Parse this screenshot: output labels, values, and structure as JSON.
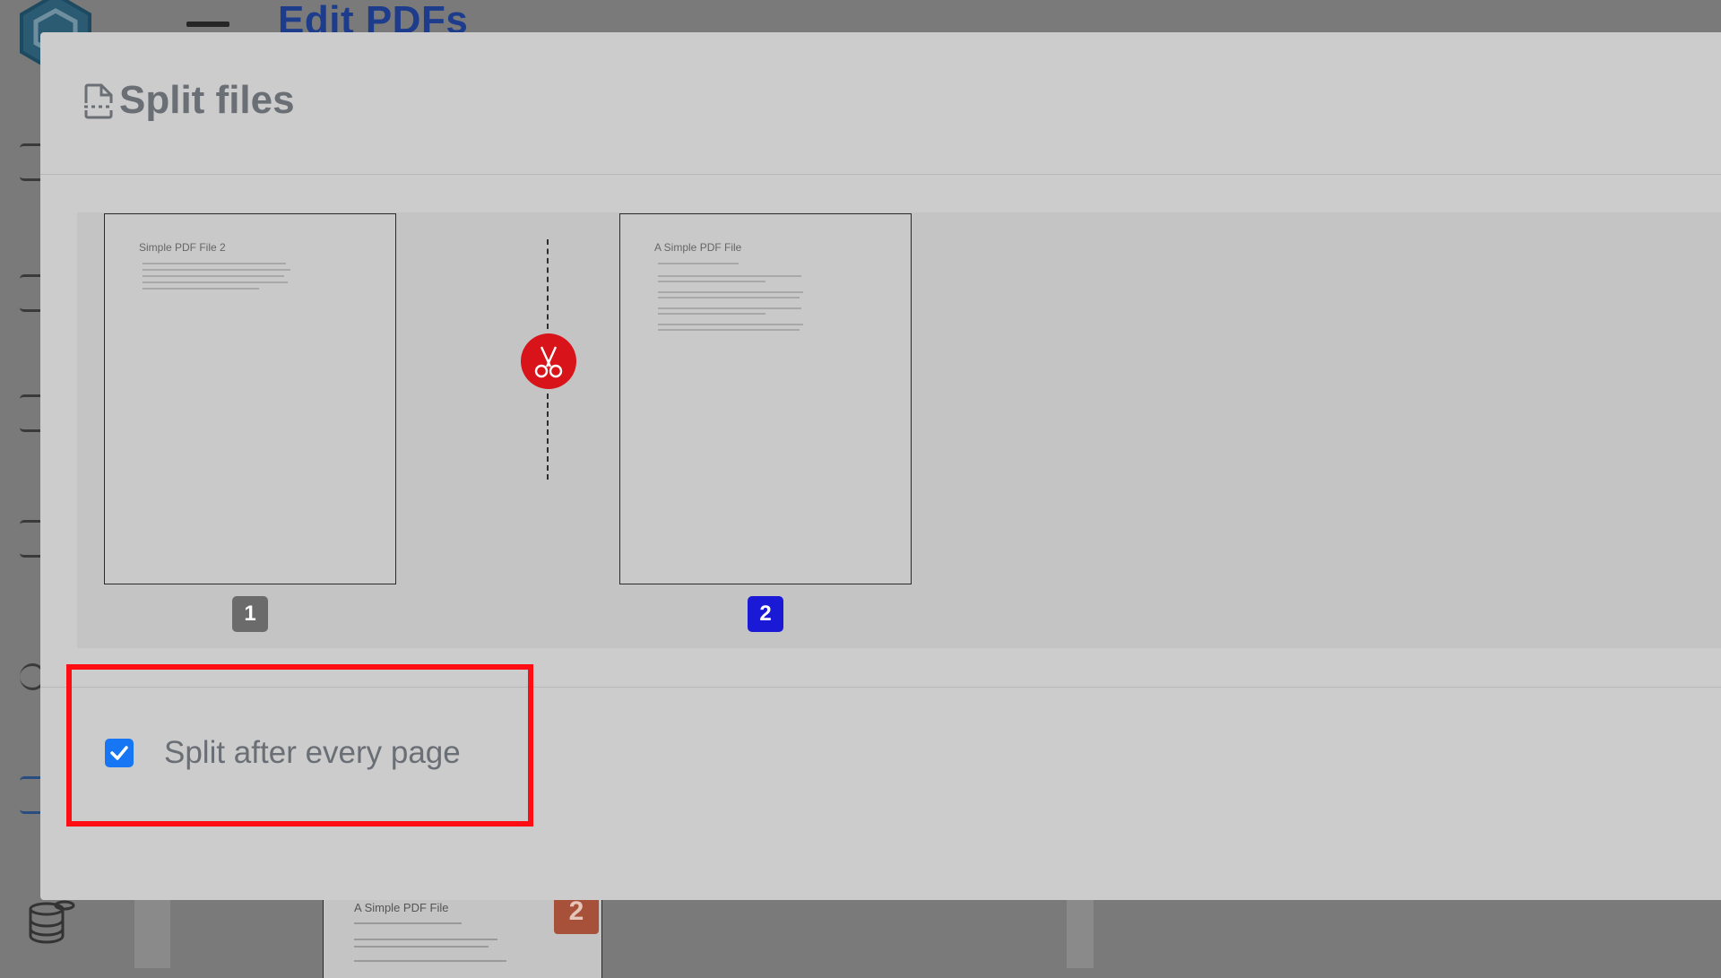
{
  "background": {
    "title": "Edit PDFs",
    "page_heading": "A Simple PDF File",
    "page_number": "2"
  },
  "modal": {
    "title": "Split files",
    "title_icon": "file-split-icon",
    "pages": [
      {
        "heading": "Simple PDF File 2",
        "number": "1",
        "badge_color": "#6b6b6b"
      },
      {
        "heading": "A Simple PDF File",
        "number": "2",
        "badge_color": "#1a1ad6"
      }
    ],
    "cut_icon": "scissors-icon",
    "cut_color": "#d8141a",
    "option": {
      "label": "Split after every page",
      "checked": true
    }
  },
  "highlight_color": "#ff0d14"
}
